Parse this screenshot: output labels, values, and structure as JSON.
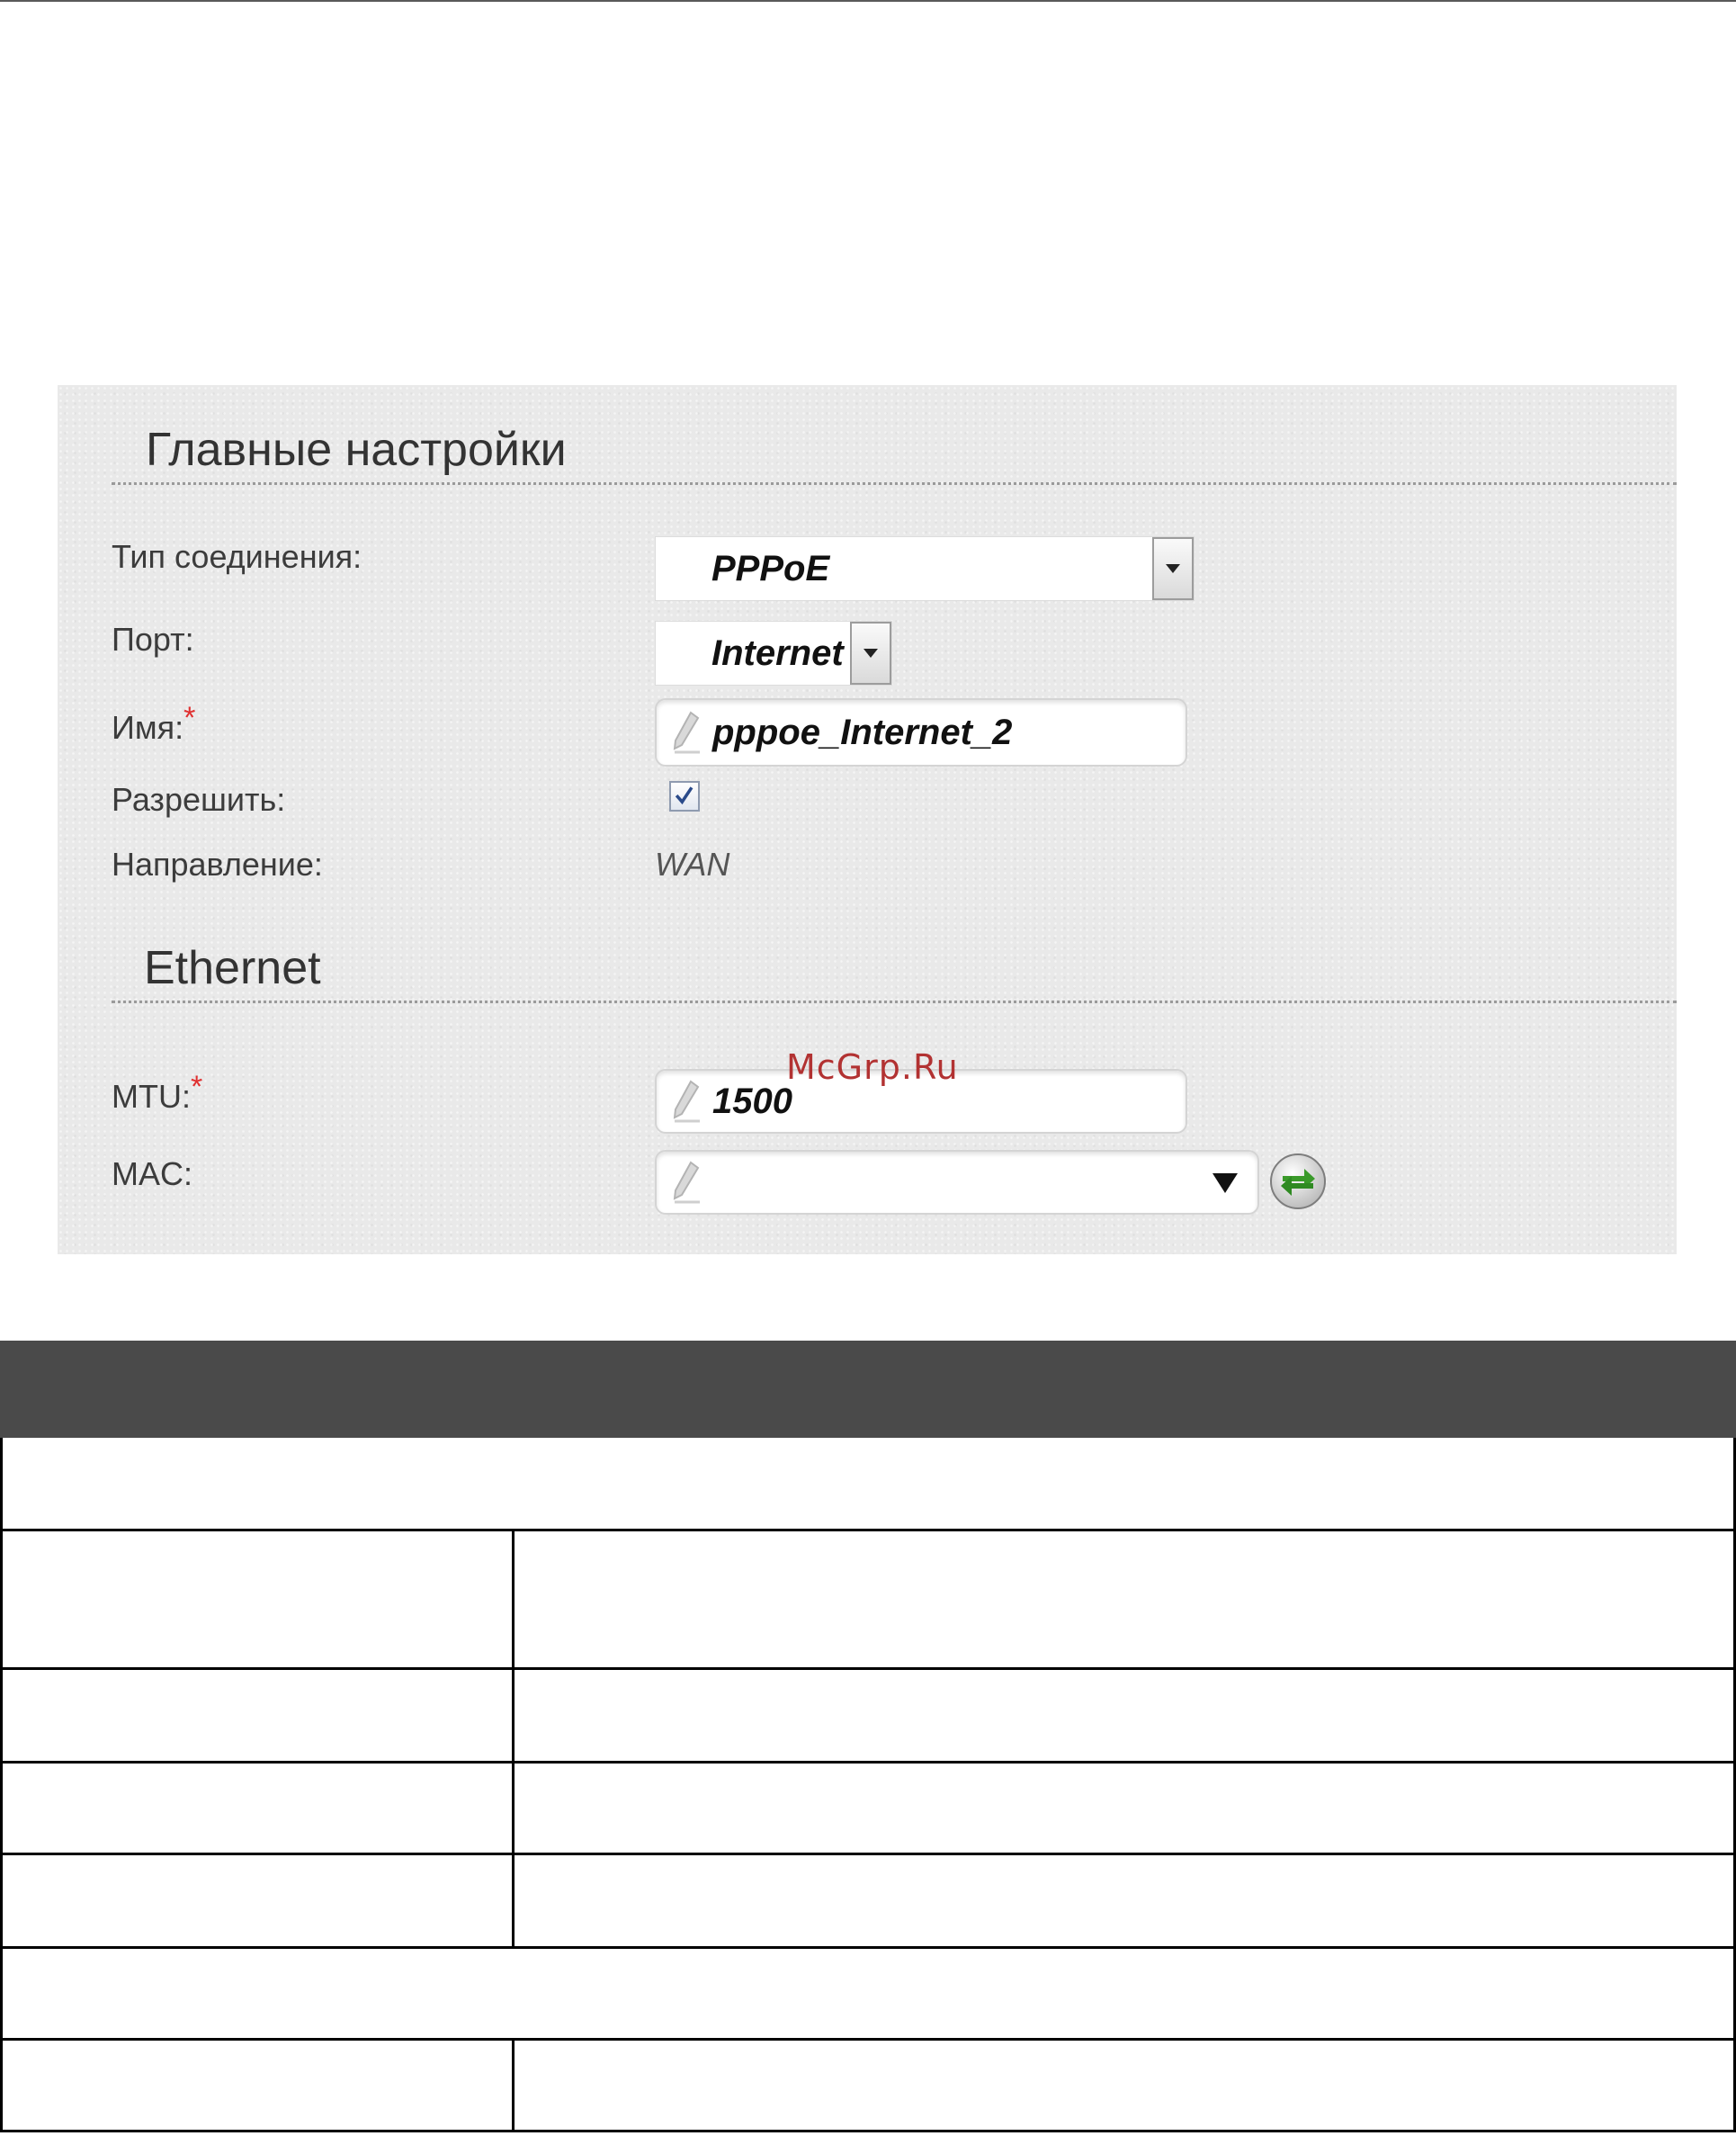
{
  "panel": {
    "main_title": "Главные настройки",
    "fields": {
      "connection_type": {
        "label": "Тип соединения:",
        "value": "PPPoE"
      },
      "port": {
        "label": "Порт:",
        "value": "Internet"
      },
      "name": {
        "label": "Имя:",
        "required_mark": "*",
        "value": "pppoe_Internet_2"
      },
      "enable": {
        "label": "Разрешить:",
        "checked": true
      },
      "direction": {
        "label": "Направление:",
        "value": "WAN"
      }
    },
    "ethernet_title": "Ethernet",
    "ethernet": {
      "mtu": {
        "label": "MTU:",
        "required_mark": "*",
        "value": "1500"
      },
      "mac": {
        "label": "MAC:",
        "value": ""
      }
    },
    "icons": [
      "pencil-icon",
      "dropdown-arrow-icon",
      "checkbox-checked-icon",
      "refresh-arrows-icon"
    ]
  },
  "watermark": "McGrp.Ru",
  "colors": {
    "panel_bg": "#e9e9e9",
    "required": "#e03030",
    "table_header": "#4a4a4a",
    "refresh_green": "#3a9a2a"
  }
}
